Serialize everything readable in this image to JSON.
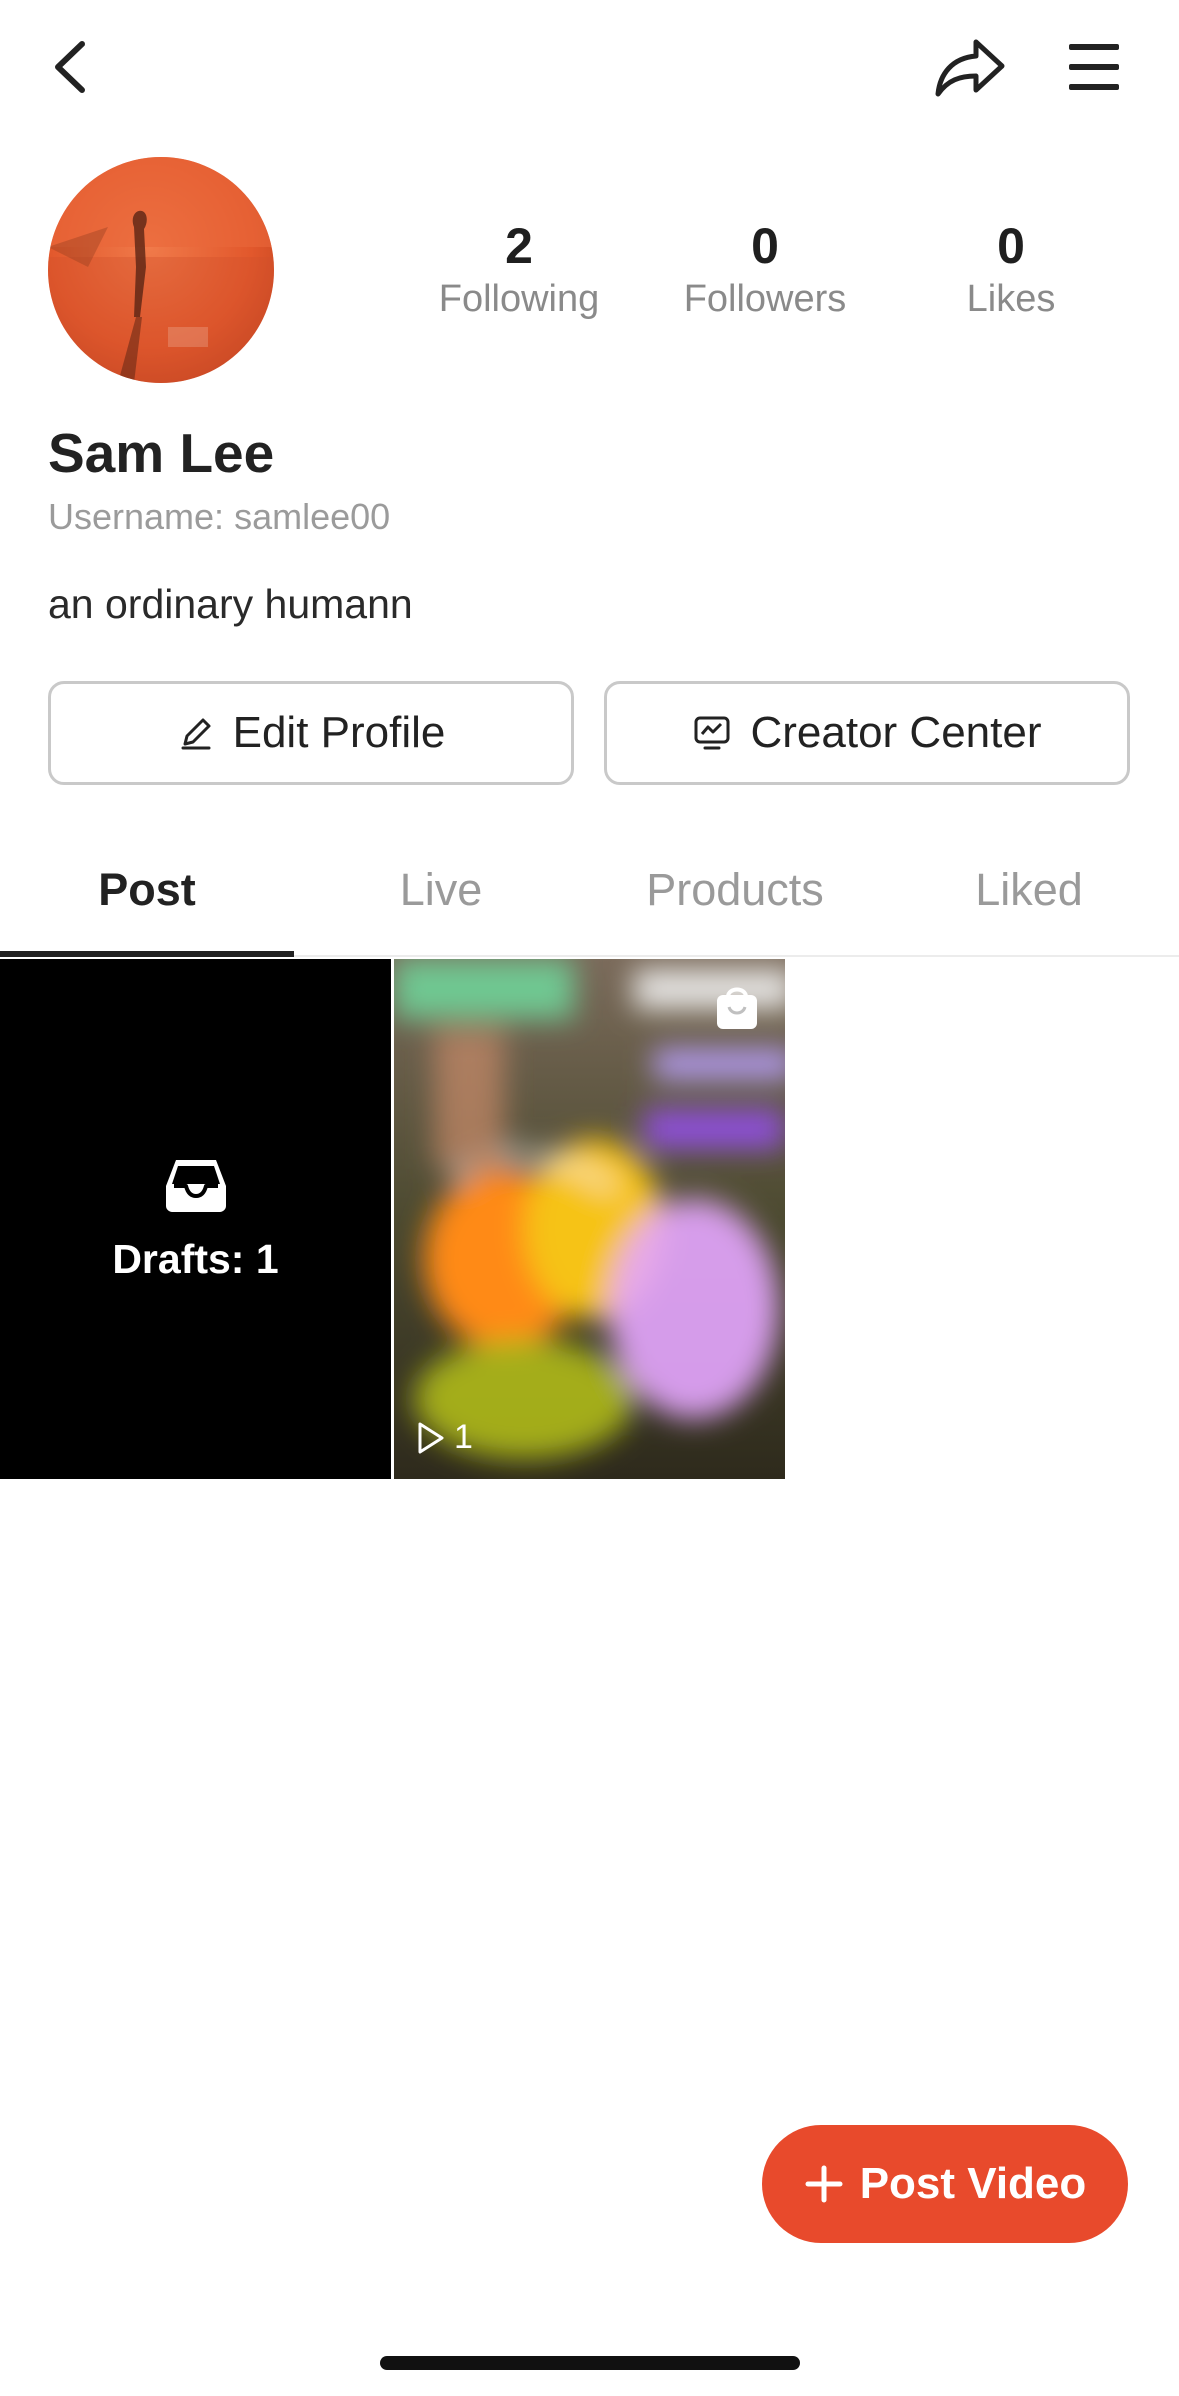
{
  "header": {
    "back_icon": "chevron-left-icon",
    "share_icon": "share-arrow-icon",
    "menu_icon": "hamburger-menu-icon"
  },
  "profile": {
    "avatar": "avatar-photo",
    "name": "Sam Lee",
    "username": "Username: samlee00",
    "bio": "an ordinary humann",
    "stats": [
      {
        "value": "2",
        "label": "Following"
      },
      {
        "value": "0",
        "label": "Followers"
      },
      {
        "value": "0",
        "label": "Likes"
      }
    ]
  },
  "actions": {
    "edit_profile": "Edit Profile",
    "creator_center": "Creator Center"
  },
  "tabs": [
    {
      "label": "Post",
      "active": true
    },
    {
      "label": "Live",
      "active": false
    },
    {
      "label": "Products",
      "active": false
    },
    {
      "label": "Liked",
      "active": false
    }
  ],
  "grid": {
    "drafts_label": "Drafts: 1",
    "video_play_count": "1"
  },
  "fab": {
    "label": "Post Video",
    "color": "#e84a2c"
  }
}
